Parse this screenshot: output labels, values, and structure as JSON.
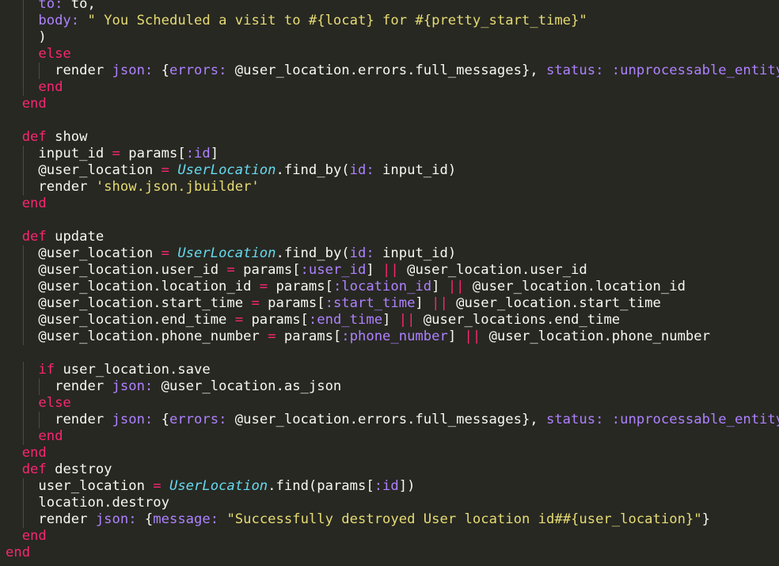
{
  "editor": {
    "theme": "monokai",
    "colors": {
      "background": "#272822",
      "plain": "#F8F8F2",
      "keyword": "#F92672",
      "function": "#A6E22E",
      "symbol": "#AE81FF",
      "string": "#E6DB74",
      "class": "#66D9EF"
    },
    "lines": [
      {
        "indent": 2,
        "tokens": [
          {
            "t": "to:",
            "c": "symbol"
          },
          {
            "t": " to,",
            "c": "plain"
          }
        ]
      },
      {
        "indent": 2,
        "tokens": [
          {
            "t": "body:",
            "c": "symbol"
          },
          {
            "t": " ",
            "c": "plain"
          },
          {
            "t": "\" You Scheduled a visit to #{locat} for #{pretty_start_time}\"",
            "c": "string"
          }
        ]
      },
      {
        "indent": 2,
        "tokens": [
          {
            "t": ")",
            "c": "plain"
          }
        ]
      },
      {
        "indent": 2,
        "tokens": [
          {
            "t": "else",
            "c": "keyword"
          }
        ]
      },
      {
        "indent": 3,
        "tokens": [
          {
            "t": "render ",
            "c": "plain"
          },
          {
            "t": "json:",
            "c": "symbol"
          },
          {
            "t": " {",
            "c": "plain"
          },
          {
            "t": "errors:",
            "c": "symbol"
          },
          {
            "t": " @user_location.errors.full_messages}, ",
            "c": "plain"
          },
          {
            "t": "status:",
            "c": "symbol"
          },
          {
            "t": " ",
            "c": "plain"
          },
          {
            "t": ":unprocessable_entity",
            "c": "symbol"
          }
        ]
      },
      {
        "indent": 2,
        "tokens": [
          {
            "t": "end",
            "c": "keyword"
          }
        ]
      },
      {
        "indent": 1,
        "tokens": [
          {
            "t": "end",
            "c": "keyword"
          }
        ]
      },
      {
        "indent": 0,
        "tokens": []
      },
      {
        "indent": 1,
        "tokens": [
          {
            "t": "def",
            "c": "keyword"
          },
          {
            "t": " ",
            "c": "plain"
          },
          {
            "t": "show",
            "c": "function"
          }
        ]
      },
      {
        "indent": 2,
        "tokens": [
          {
            "t": "input_id ",
            "c": "plain"
          },
          {
            "t": "=",
            "c": "keyword"
          },
          {
            "t": " params[",
            "c": "plain"
          },
          {
            "t": ":id",
            "c": "symbol"
          },
          {
            "t": "]",
            "c": "plain"
          }
        ]
      },
      {
        "indent": 2,
        "tokens": [
          {
            "t": "@user_location ",
            "c": "plain"
          },
          {
            "t": "=",
            "c": "keyword"
          },
          {
            "t": " ",
            "c": "plain"
          },
          {
            "t": "UserLocation",
            "c": "class"
          },
          {
            "t": ".find_by(",
            "c": "plain"
          },
          {
            "t": "id:",
            "c": "symbol"
          },
          {
            "t": " input_id)",
            "c": "plain"
          }
        ]
      },
      {
        "indent": 2,
        "tokens": [
          {
            "t": "render ",
            "c": "plain"
          },
          {
            "t": "'show.json.jbuilder'",
            "c": "string"
          }
        ]
      },
      {
        "indent": 1,
        "tokens": [
          {
            "t": "end",
            "c": "keyword"
          }
        ]
      },
      {
        "indent": 0,
        "tokens": []
      },
      {
        "indent": 1,
        "tokens": [
          {
            "t": "def",
            "c": "keyword"
          },
          {
            "t": " ",
            "c": "plain"
          },
          {
            "t": "update",
            "c": "function"
          }
        ]
      },
      {
        "indent": 2,
        "tokens": [
          {
            "t": "@user_location ",
            "c": "plain"
          },
          {
            "t": "=",
            "c": "keyword"
          },
          {
            "t": " ",
            "c": "plain"
          },
          {
            "t": "UserLocation",
            "c": "class"
          },
          {
            "t": ".find_by(",
            "c": "plain"
          },
          {
            "t": "id:",
            "c": "symbol"
          },
          {
            "t": " input_id)",
            "c": "plain"
          }
        ]
      },
      {
        "indent": 2,
        "tokens": [
          {
            "t": "@user_location.user_id ",
            "c": "plain"
          },
          {
            "t": "=",
            "c": "keyword"
          },
          {
            "t": " params[",
            "c": "plain"
          },
          {
            "t": ":user_id",
            "c": "symbol"
          },
          {
            "t": "] ",
            "c": "plain"
          },
          {
            "t": "||",
            "c": "keyword"
          },
          {
            "t": " @user_location.user_id",
            "c": "plain"
          }
        ]
      },
      {
        "indent": 2,
        "tokens": [
          {
            "t": "@user_location.location_id ",
            "c": "plain"
          },
          {
            "t": "=",
            "c": "keyword"
          },
          {
            "t": " params[",
            "c": "plain"
          },
          {
            "t": ":location_id",
            "c": "symbol"
          },
          {
            "t": "] ",
            "c": "plain"
          },
          {
            "t": "||",
            "c": "keyword"
          },
          {
            "t": " @user_location.location_id",
            "c": "plain"
          }
        ]
      },
      {
        "indent": 2,
        "tokens": [
          {
            "t": "@user_location.start_time ",
            "c": "plain"
          },
          {
            "t": "=",
            "c": "keyword"
          },
          {
            "t": " params[",
            "c": "plain"
          },
          {
            "t": ":start_time",
            "c": "symbol"
          },
          {
            "t": "] ",
            "c": "plain"
          },
          {
            "t": "||",
            "c": "keyword"
          },
          {
            "t": " @user_location.start_time",
            "c": "plain"
          }
        ]
      },
      {
        "indent": 2,
        "tokens": [
          {
            "t": "@user_location.end_time ",
            "c": "plain"
          },
          {
            "t": "=",
            "c": "keyword"
          },
          {
            "t": " params[",
            "c": "plain"
          },
          {
            "t": ":end_time",
            "c": "symbol"
          },
          {
            "t": "] ",
            "c": "plain"
          },
          {
            "t": "||",
            "c": "keyword"
          },
          {
            "t": " @user_locations.end_time",
            "c": "plain"
          }
        ]
      },
      {
        "indent": 2,
        "tokens": [
          {
            "t": "@user_location.phone_number ",
            "c": "plain"
          },
          {
            "t": "=",
            "c": "keyword"
          },
          {
            "t": " params[",
            "c": "plain"
          },
          {
            "t": ":phone_number",
            "c": "symbol"
          },
          {
            "t": "] ",
            "c": "plain"
          },
          {
            "t": "||",
            "c": "keyword"
          },
          {
            "t": " @user_location.phone_number",
            "c": "plain"
          }
        ]
      },
      {
        "indent": 0,
        "tokens": []
      },
      {
        "indent": 2,
        "tokens": [
          {
            "t": "if",
            "c": "keyword"
          },
          {
            "t": " user_location.save",
            "c": "plain"
          }
        ]
      },
      {
        "indent": 3,
        "tokens": [
          {
            "t": "render ",
            "c": "plain"
          },
          {
            "t": "json:",
            "c": "symbol"
          },
          {
            "t": " @user_location.as_json",
            "c": "plain"
          }
        ]
      },
      {
        "indent": 2,
        "tokens": [
          {
            "t": "else",
            "c": "keyword"
          }
        ]
      },
      {
        "indent": 3,
        "tokens": [
          {
            "t": "render ",
            "c": "plain"
          },
          {
            "t": "json:",
            "c": "symbol"
          },
          {
            "t": " {",
            "c": "plain"
          },
          {
            "t": "errors:",
            "c": "symbol"
          },
          {
            "t": " @user_location.errors.full_messages}, ",
            "c": "plain"
          },
          {
            "t": "status:",
            "c": "symbol"
          },
          {
            "t": " ",
            "c": "plain"
          },
          {
            "t": ":unprocessable_entity",
            "c": "symbol"
          }
        ]
      },
      {
        "indent": 2,
        "tokens": [
          {
            "t": "end",
            "c": "keyword"
          }
        ]
      },
      {
        "indent": 1,
        "tokens": [
          {
            "t": "end",
            "c": "keyword"
          }
        ]
      },
      {
        "indent": 1,
        "tokens": [
          {
            "t": "def",
            "c": "keyword"
          },
          {
            "t": " ",
            "c": "plain"
          },
          {
            "t": "destroy",
            "c": "function"
          }
        ]
      },
      {
        "indent": 2,
        "tokens": [
          {
            "t": "user_location ",
            "c": "plain"
          },
          {
            "t": "=",
            "c": "keyword"
          },
          {
            "t": " ",
            "c": "plain"
          },
          {
            "t": "UserLocation",
            "c": "class"
          },
          {
            "t": ".find(params[",
            "c": "plain"
          },
          {
            "t": ":id",
            "c": "symbol"
          },
          {
            "t": "])",
            "c": "plain"
          }
        ]
      },
      {
        "indent": 2,
        "tokens": [
          {
            "t": "location.destroy",
            "c": "plain"
          }
        ]
      },
      {
        "indent": 2,
        "tokens": [
          {
            "t": "render ",
            "c": "plain"
          },
          {
            "t": "json:",
            "c": "symbol"
          },
          {
            "t": " {",
            "c": "plain"
          },
          {
            "t": "message:",
            "c": "symbol"
          },
          {
            "t": " ",
            "c": "plain"
          },
          {
            "t": "\"Successfully destroyed User location id##{user_location}\"",
            "c": "string"
          },
          {
            "t": "}",
            "c": "plain"
          }
        ]
      },
      {
        "indent": 1,
        "tokens": [
          {
            "t": "end",
            "c": "keyword"
          }
        ]
      },
      {
        "indent": 0,
        "tokens": [
          {
            "t": "end",
            "c": "keyword"
          }
        ]
      }
    ]
  }
}
